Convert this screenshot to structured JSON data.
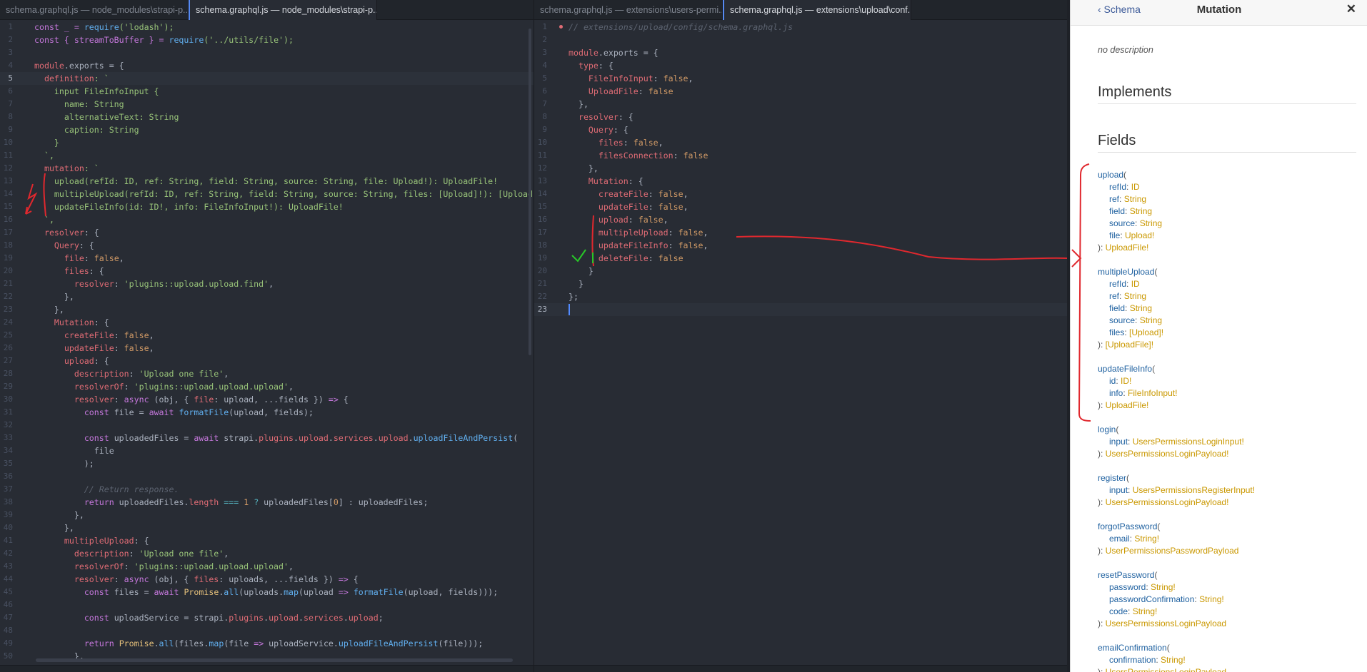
{
  "editor": {
    "left": {
      "tabs": [
        {
          "label": "schema.graphql.js — node_modules\\strapi-p...",
          "active": false
        },
        {
          "label": "schema.graphql.js — node_modules\\strapi-p...",
          "active": true
        }
      ],
      "lines": [
        [
          [
            "const _ = ",
            "k"
          ],
          [
            "require",
            "f"
          ],
          [
            "('lodash');",
            "s"
          ]
        ],
        [
          [
            "const { streamToBuffer } = ",
            "k"
          ],
          [
            "require",
            "f"
          ],
          [
            "('../utils/file');",
            "s"
          ]
        ],
        [],
        [
          [
            "module",
            "p"
          ],
          [
            ".exports = {",
            ""
          ]
        ],
        [
          [
            "  definition",
            "p"
          ],
          [
            ": `",
            "s"
          ]
        ],
        [
          [
            "    input FileInfoInput {",
            "s"
          ]
        ],
        [
          [
            "      name: String",
            "s"
          ]
        ],
        [
          [
            "      alternativeText: String",
            "s"
          ]
        ],
        [
          [
            "      caption: String",
            "s"
          ]
        ],
        [
          [
            "    }",
            "s"
          ]
        ],
        [
          [
            "  `,",
            "s"
          ]
        ],
        [
          [
            "  mutation",
            "p"
          ],
          [
            ": `",
            "s"
          ]
        ],
        [
          [
            "    upload(refId: ID, ref: String, field: String, source: String, file: Upload!): UploadFile!",
            "s"
          ]
        ],
        [
          [
            "    multipleUpload(refId: ID, ref: String, field: String, source: String, files: [Upload]!): [UploadFile]!",
            "s"
          ]
        ],
        [
          [
            "    updateFileInfo(id: ID!, info: FileInfoInput!): UploadFile!",
            "s"
          ]
        ],
        [
          [
            "  `,",
            "s"
          ]
        ],
        [
          [
            "  resolver",
            "p"
          ],
          [
            ": {",
            ""
          ]
        ],
        [
          [
            "    Query",
            "p"
          ],
          [
            ": {",
            ""
          ]
        ],
        [
          [
            "      file",
            "p"
          ],
          [
            ": ",
            ""
          ],
          [
            "false",
            "n"
          ],
          [
            ",",
            ""
          ]
        ],
        [
          [
            "      files",
            "p"
          ],
          [
            ": {",
            ""
          ]
        ],
        [
          [
            "        resolver",
            "p"
          ],
          [
            ": ",
            ""
          ],
          [
            "'plugins::upload.upload.find'",
            "s"
          ],
          [
            ",",
            ""
          ]
        ],
        [
          [
            "      },",
            ""
          ]
        ],
        [
          [
            "    },",
            ""
          ]
        ],
        [
          [
            "    Mutation",
            "p"
          ],
          [
            ": {",
            ""
          ]
        ],
        [
          [
            "      createFile",
            "p"
          ],
          [
            ": ",
            ""
          ],
          [
            "false",
            "n"
          ],
          [
            ",",
            ""
          ]
        ],
        [
          [
            "      updateFile",
            "p"
          ],
          [
            ": ",
            ""
          ],
          [
            "false",
            "n"
          ],
          [
            ",",
            ""
          ]
        ],
        [
          [
            "      upload",
            "p"
          ],
          [
            ": {",
            ""
          ]
        ],
        [
          [
            "        description",
            "p"
          ],
          [
            ": ",
            ""
          ],
          [
            "'Upload one file'",
            "s"
          ],
          [
            ",",
            ""
          ]
        ],
        [
          [
            "        resolverOf",
            "p"
          ],
          [
            ": ",
            ""
          ],
          [
            "'plugins::upload.upload.upload'",
            "s"
          ],
          [
            ",",
            ""
          ]
        ],
        [
          [
            "        resolver",
            "p"
          ],
          [
            ": ",
            ""
          ],
          [
            "async",
            "k"
          ],
          [
            " (obj, { ",
            ""
          ],
          [
            "file",
            "p"
          ],
          [
            ": upload, ...fields }) ",
            ""
          ],
          [
            "=>",
            "k"
          ],
          [
            " {",
            ""
          ]
        ],
        [
          [
            "          ",
            ""
          ],
          [
            "const",
            "k"
          ],
          [
            " file = ",
            ""
          ],
          [
            "await",
            "k"
          ],
          [
            " ",
            ""
          ],
          [
            "formatFile",
            "f"
          ],
          [
            "(upload, fields);",
            ""
          ]
        ],
        [],
        [
          [
            "          ",
            ""
          ],
          [
            "const",
            "k"
          ],
          [
            " uploadedFiles = ",
            ""
          ],
          [
            "await",
            "k"
          ],
          [
            " strapi.",
            ""
          ],
          [
            "plugins",
            "p"
          ],
          [
            ".",
            ""
          ],
          [
            "upload",
            "p"
          ],
          [
            ".",
            ""
          ],
          [
            "services",
            "p"
          ],
          [
            ".",
            ""
          ],
          [
            "upload",
            "p"
          ],
          [
            ".",
            ""
          ],
          [
            "uploadFileAndPersist",
            "f"
          ],
          [
            "(",
            ""
          ]
        ],
        [
          [
            "            file",
            ""
          ]
        ],
        [
          [
            "          );",
            ""
          ]
        ],
        [],
        [
          [
            "          // Return response.",
            "c"
          ]
        ],
        [
          [
            "          ",
            ""
          ],
          [
            "return",
            "k"
          ],
          [
            " uploadedFiles.",
            ""
          ],
          [
            "length",
            "p"
          ],
          [
            " ",
            ""
          ],
          [
            "===",
            "o"
          ],
          [
            " ",
            ""
          ],
          [
            "1",
            "n"
          ],
          [
            " ",
            ""
          ],
          [
            "?",
            "o"
          ],
          [
            " uploadedFiles[",
            ""
          ],
          [
            "0",
            "n"
          ],
          [
            "] : uploadedFiles;",
            ""
          ]
        ],
        [
          [
            "        },",
            ""
          ]
        ],
        [
          [
            "      },",
            ""
          ]
        ],
        [
          [
            "      multipleUpload",
            "p"
          ],
          [
            ": {",
            ""
          ]
        ],
        [
          [
            "        description",
            "p"
          ],
          [
            ": ",
            ""
          ],
          [
            "'Upload one file'",
            "s"
          ],
          [
            ",",
            ""
          ]
        ],
        [
          [
            "        resolverOf",
            "p"
          ],
          [
            ": ",
            ""
          ],
          [
            "'plugins::upload.upload.upload'",
            "s"
          ],
          [
            ",",
            ""
          ]
        ],
        [
          [
            "        resolver",
            "p"
          ],
          [
            ": ",
            ""
          ],
          [
            "async",
            "k"
          ],
          [
            " (obj, { ",
            ""
          ],
          [
            "files",
            "p"
          ],
          [
            ": uploads, ...fields }) ",
            ""
          ],
          [
            "=>",
            "k"
          ],
          [
            " {",
            ""
          ]
        ],
        [
          [
            "          ",
            ""
          ],
          [
            "const",
            "k"
          ],
          [
            " files = ",
            ""
          ],
          [
            "await",
            "k"
          ],
          [
            " ",
            ""
          ],
          [
            "Promise",
            "y"
          ],
          [
            ".",
            ""
          ],
          [
            "all",
            "f"
          ],
          [
            "(uploads.",
            ""
          ],
          [
            "map",
            "f"
          ],
          [
            "(upload ",
            ""
          ],
          [
            "=>",
            "k"
          ],
          [
            " ",
            ""
          ],
          [
            "formatFile",
            "f"
          ],
          [
            "(upload, fields)));",
            ""
          ]
        ],
        [],
        [
          [
            "          ",
            ""
          ],
          [
            "const",
            "k"
          ],
          [
            " uploadService = strapi.",
            ""
          ],
          [
            "plugins",
            "p"
          ],
          [
            ".",
            ""
          ],
          [
            "upload",
            "p"
          ],
          [
            ".",
            ""
          ],
          [
            "services",
            "p"
          ],
          [
            ".",
            ""
          ],
          [
            "upload",
            "p"
          ],
          [
            ";",
            ""
          ]
        ],
        [],
        [
          [
            "          ",
            ""
          ],
          [
            "return",
            "k"
          ],
          [
            " ",
            ""
          ],
          [
            "Promise",
            "y"
          ],
          [
            ".",
            ""
          ],
          [
            "all",
            "f"
          ],
          [
            "(files.",
            ""
          ],
          [
            "map",
            "f"
          ],
          [
            "(file ",
            ""
          ],
          [
            "=>",
            "k"
          ],
          [
            " uploadService.",
            ""
          ],
          [
            "uploadFileAndPersist",
            "f"
          ],
          [
            "(file)));",
            ""
          ]
        ],
        [
          [
            "        },",
            ""
          ]
        ]
      ],
      "line_numbers": [
        "1",
        "2",
        "3",
        "4",
        "5",
        "6",
        "7",
        "8",
        "9",
        "10",
        "11",
        "12",
        "13",
        "14",
        "15",
        "16",
        "17",
        "18",
        "19",
        "20",
        "21",
        "22",
        "23",
        "24",
        "25",
        "26",
        "27",
        "28",
        "29",
        "30",
        "31",
        "32",
        "33",
        "34",
        "35",
        "36",
        "37",
        "38",
        "39",
        "40",
        "41",
        "42",
        "43",
        "44",
        "45",
        "46",
        "47",
        "48",
        "49",
        "50"
      ],
      "cursor_line": 5
    },
    "right": {
      "tabs": [
        {
          "label": "schema.graphql.js — extensions\\users-permi...",
          "active": false
        },
        {
          "label": "schema.graphql.js — extensions\\upload\\conf...",
          "active": true
        }
      ],
      "lines": [
        [
          [
            "// extensions/upload/config/schema.graphql.js",
            "c"
          ]
        ],
        [],
        [
          [
            "module",
            "p"
          ],
          [
            ".exports = {",
            ""
          ]
        ],
        [
          [
            "  type",
            "p"
          ],
          [
            ": {",
            ""
          ]
        ],
        [
          [
            "    FileInfoInput",
            "p"
          ],
          [
            ": ",
            ""
          ],
          [
            "false",
            "n"
          ],
          [
            ",",
            ""
          ]
        ],
        [
          [
            "    UploadFile",
            "p"
          ],
          [
            ": ",
            ""
          ],
          [
            "false",
            "n"
          ]
        ],
        [
          [
            "  },",
            ""
          ]
        ],
        [
          [
            "  resolver",
            "p"
          ],
          [
            ": {",
            ""
          ]
        ],
        [
          [
            "    Query",
            "p"
          ],
          [
            ": {",
            ""
          ]
        ],
        [
          [
            "      files",
            "p"
          ],
          [
            ": ",
            ""
          ],
          [
            "false",
            "n"
          ],
          [
            ",",
            ""
          ]
        ],
        [
          [
            "      filesConnection",
            "p"
          ],
          [
            ": ",
            ""
          ],
          [
            "false",
            "n"
          ]
        ],
        [
          [
            "    },",
            ""
          ]
        ],
        [
          [
            "    Mutation",
            "p"
          ],
          [
            ": {",
            ""
          ]
        ],
        [
          [
            "      createFile",
            "p"
          ],
          [
            ": ",
            ""
          ],
          [
            "false",
            "n"
          ],
          [
            ",",
            ""
          ]
        ],
        [
          [
            "      updateFile",
            "p"
          ],
          [
            ": ",
            ""
          ],
          [
            "false",
            "n"
          ],
          [
            ",",
            ""
          ]
        ],
        [
          [
            "      upload",
            "p"
          ],
          [
            ": ",
            ""
          ],
          [
            "false",
            "n"
          ],
          [
            ",",
            ""
          ]
        ],
        [
          [
            "      multipleUpload",
            "p"
          ],
          [
            ": ",
            ""
          ],
          [
            "false",
            "n"
          ],
          [
            ",",
            ""
          ]
        ],
        [
          [
            "      updateFileInfo",
            "p"
          ],
          [
            ": ",
            ""
          ],
          [
            "false",
            "n"
          ],
          [
            ",",
            ""
          ]
        ],
        [
          [
            "      deleteFile",
            "p"
          ],
          [
            ": ",
            ""
          ],
          [
            "false",
            "n"
          ]
        ],
        [
          [
            "    }",
            ""
          ]
        ],
        [
          [
            "  }",
            ""
          ]
        ],
        [
          [
            "};",
            ""
          ]
        ],
        []
      ],
      "line_numbers": [
        "1",
        "2",
        "3",
        "4",
        "5",
        "6",
        "7",
        "8",
        "9",
        "10",
        "11",
        "12",
        "13",
        "14",
        "15",
        "16",
        "17",
        "18",
        "19",
        "20",
        "21",
        "22",
        "23"
      ],
      "cursor_line": 23
    }
  },
  "doc": {
    "back_label": "‹ Schema",
    "title": "Mutation",
    "close_label": "✕",
    "description": "no description",
    "implements_heading": "Implements",
    "fields_heading": "Fields",
    "fields": [
      {
        "name": "upload",
        "args": [
          [
            "refId",
            "ID"
          ],
          [
            "ref",
            "String"
          ],
          [
            "field",
            "String"
          ],
          [
            "source",
            "String"
          ],
          [
            "file",
            "Upload!"
          ]
        ],
        "returns": "UploadFile!"
      },
      {
        "name": "multipleUpload",
        "args": [
          [
            "refId",
            "ID"
          ],
          [
            "ref",
            "String"
          ],
          [
            "field",
            "String"
          ],
          [
            "source",
            "String"
          ],
          [
            "files",
            "[Upload]!"
          ]
        ],
        "returns": "[UploadFile]!"
      },
      {
        "name": "updateFileInfo",
        "args": [
          [
            "id",
            "ID!"
          ],
          [
            "info",
            "FileInfoInput!"
          ]
        ],
        "returns": "UploadFile!"
      },
      {
        "name": "login",
        "args": [
          [
            "input",
            "UsersPermissionsLoginInput!"
          ]
        ],
        "returns": "UsersPermissionsLoginPayload!"
      },
      {
        "name": "register",
        "args": [
          [
            "input",
            "UsersPermissionsRegisterInput!"
          ]
        ],
        "returns": "UsersPermissionsLoginPayload!"
      },
      {
        "name": "forgotPassword",
        "args": [
          [
            "email",
            "String!"
          ]
        ],
        "returns": "UserPermissionsPasswordPayload"
      },
      {
        "name": "resetPassword",
        "args": [
          [
            "password",
            "String!"
          ],
          [
            "passwordConfirmation",
            "String!"
          ],
          [
            "code",
            "String!"
          ]
        ],
        "returns": "UsersPermissionsLoginPayload"
      },
      {
        "name": "emailConfirmation",
        "args": [
          [
            "confirmation",
            "String!"
          ]
        ],
        "returns": "UsersPermissionsLoginPayload"
      }
    ]
  }
}
